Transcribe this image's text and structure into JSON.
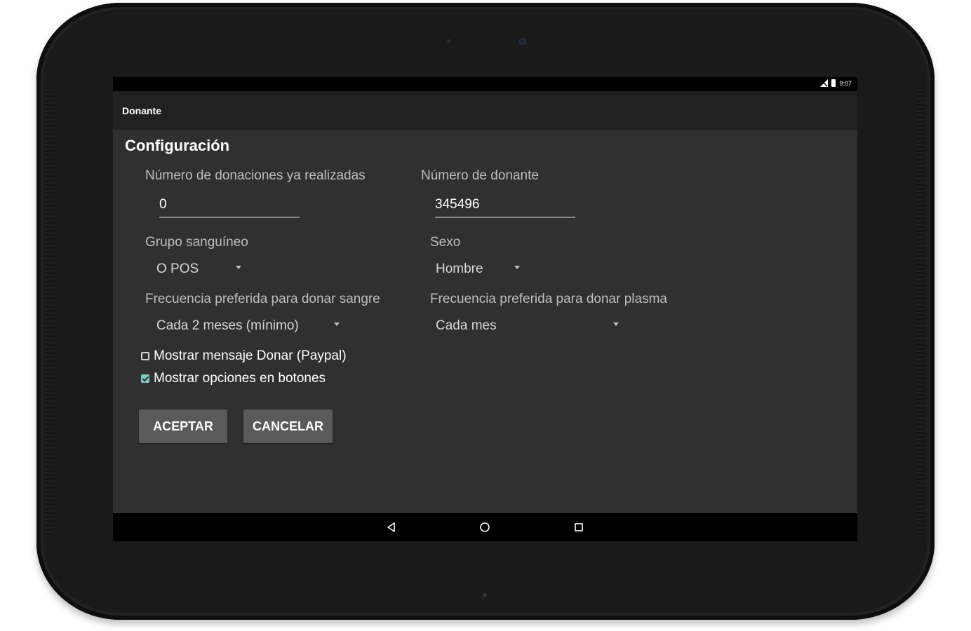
{
  "status_bar": {
    "time": "9:07"
  },
  "app_bar": {
    "title": "Donante"
  },
  "settings": {
    "section_title": "Configuración",
    "donations_count": {
      "label": "Número de donaciones ya realizadas",
      "value": "0"
    },
    "donor_number": {
      "label": "Número de donante",
      "value": "345496"
    },
    "blood_group": {
      "label": "Grupo sanguíneo",
      "selected": "O POS"
    },
    "sex": {
      "label": "Sexo",
      "selected": "Hombre"
    },
    "blood_frequency": {
      "label": "Frecuencia preferida para donar sangre",
      "selected": "Cada 2 meses (mínimo)"
    },
    "plasma_frequency": {
      "label": "Frecuencia preferida para donar plasma",
      "selected": "Cada mes"
    },
    "show_donate_message": {
      "label": "Mostrar mensaje Donar (Paypal)",
      "checked": false
    },
    "show_button_options": {
      "label": "Mostrar opciones en botones",
      "checked": true
    }
  },
  "buttons": {
    "accept": "ACEPTAR",
    "cancel": "CANCELAR"
  },
  "navigation": {
    "back_icon": "back-triangle",
    "home_icon": "home-circle",
    "recents_icon": "recents-square"
  },
  "colors": {
    "accent": "#80cbc4",
    "background": "#303030",
    "action_bar": "#212121"
  }
}
